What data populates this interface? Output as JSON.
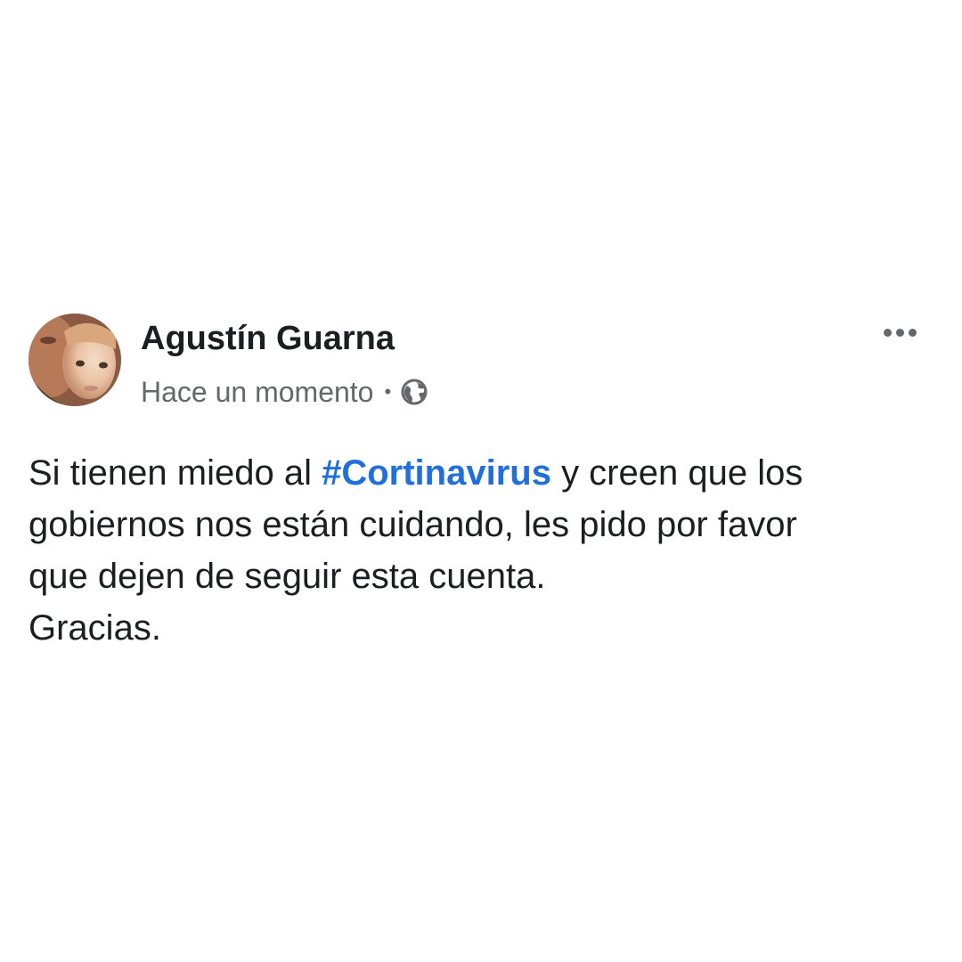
{
  "post": {
    "author": "Agustín Guarna",
    "timestamp": "Hace un momento",
    "separator": "•",
    "privacy_icon": "globe-icon",
    "more_icon": "more-options-icon",
    "hashtag_color": "#216fdb",
    "text": {
      "line1_before": "Si tienen miedo al ",
      "hashtag": "#Cortinavirus",
      "line1_after": " y creen que los",
      "line2": "gobiernos nos están cuidando, les pido por favor",
      "line3": "que dejen de seguir esta cuenta.",
      "line4": "Gracias."
    }
  }
}
